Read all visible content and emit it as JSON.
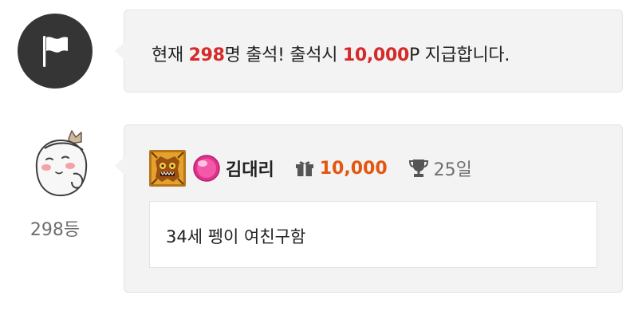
{
  "notice": {
    "text_before": "현재 ",
    "count": "298",
    "text_middle": "명 출석! 출석시 ",
    "reward": "10,000",
    "text_after": "P 지급합니다.",
    "icon": "flag-icon"
  },
  "entry": {
    "rank_label": "298등",
    "username": "김대리",
    "points": "10,000",
    "streak": "25일",
    "comment": "34세 펭이 여친구함",
    "icons": {
      "level": "level-badge-icon",
      "gem": "pink-gem-icon",
      "gift": "gift-icon",
      "trophy": "trophy-icon"
    }
  },
  "colors": {
    "accent_red": "#d62a2a",
    "points_orange": "#e2560f",
    "bubble_bg": "#f3f3f3",
    "flag_circle": "#353535"
  }
}
